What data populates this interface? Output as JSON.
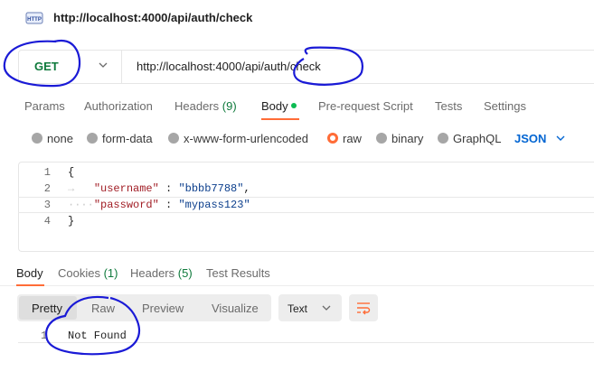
{
  "title": "http://localhost:4000/api/auth/check",
  "request": {
    "method": "GET",
    "url": "http://localhost:4000/api/auth/check"
  },
  "tabs": [
    {
      "label": "Params"
    },
    {
      "label": "Authorization"
    },
    {
      "label": "Headers",
      "count": "(9)"
    },
    {
      "label": "Body"
    },
    {
      "label": "Pre-request Script"
    },
    {
      "label": "Tests"
    },
    {
      "label": "Settings"
    }
  ],
  "body_types": [
    {
      "label": "none"
    },
    {
      "label": "form-data"
    },
    {
      "label": "x-www-form-urlencoded"
    },
    {
      "label": "raw",
      "selected": true
    },
    {
      "label": "binary"
    },
    {
      "label": "GraphQL"
    }
  ],
  "format": "JSON",
  "editor": {
    "line_numbers": [
      "1",
      "2",
      "3",
      "4"
    ],
    "open_brace": "{",
    "close_brace": "}",
    "key1": "\"username\"",
    "val1": "\"bbbb7788\"",
    "key2": "\"password\"",
    "val2": "\"mypass123\""
  },
  "response": {
    "tabs": [
      {
        "label": "Body"
      },
      {
        "label": "Cookies",
        "count": "(1)"
      },
      {
        "label": "Headers",
        "count": "(5)"
      },
      {
        "label": "Test Results"
      }
    ],
    "views": [
      "Pretty",
      "Raw",
      "Preview",
      "Visualize"
    ],
    "text_format": "Text",
    "line_number": "1",
    "content": "Not Found"
  },
  "colors": {
    "accent": "#ff6c37",
    "get_method": "#0f7a3c",
    "json_link": "#0265d2",
    "annotation_ink": "#1a1ad6"
  }
}
